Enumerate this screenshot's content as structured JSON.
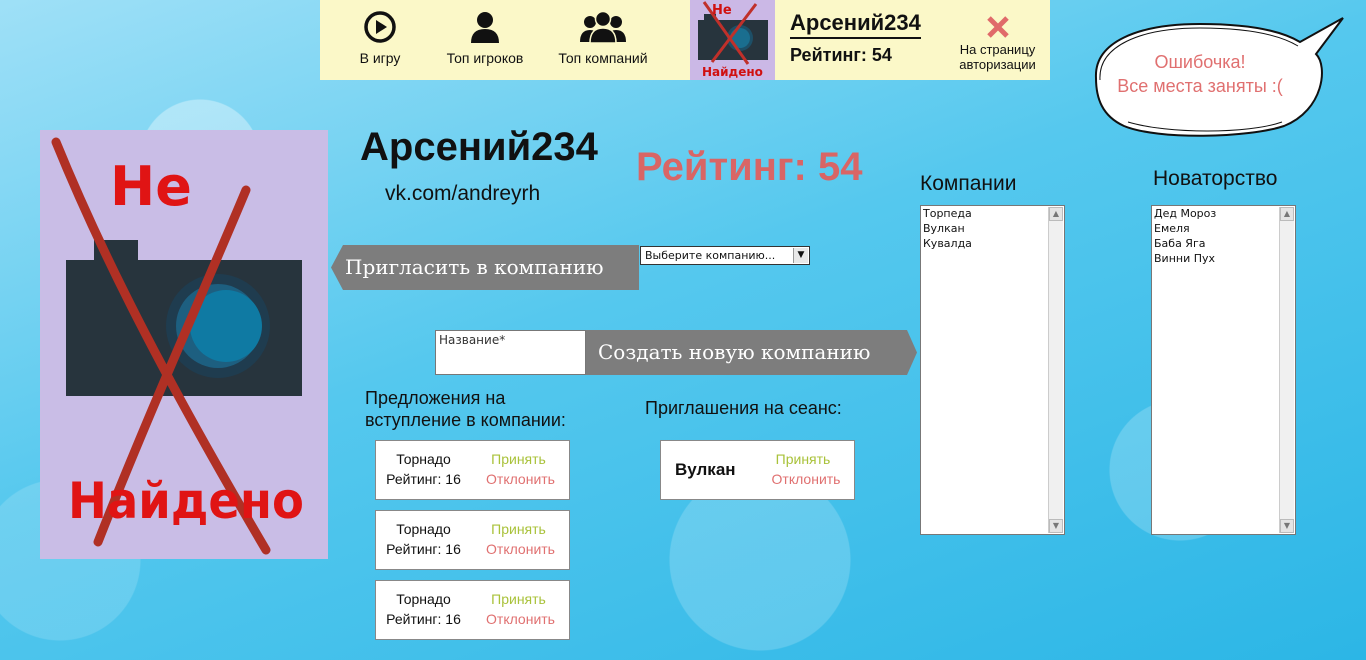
{
  "nav": {
    "play_label": "В игру",
    "top_players_label": "Топ игроков",
    "top_companies_label": "Топ компаний"
  },
  "header": {
    "username": "Арсений234",
    "rating": "Рейтинг: 54",
    "logout_line1": "На страницу",
    "logout_line2": "авторизации"
  },
  "notice": {
    "line1": "Ошибочка!",
    "line2": "Все места заняты :("
  },
  "profile": {
    "name": "Арсений234",
    "link": "vk.com/andreyrh",
    "rating": "Рейтинг: 54",
    "avatar_text_top": "Не",
    "avatar_text_bottom": "Найдено"
  },
  "invite": {
    "button_label": "Пригласить в компанию",
    "select_value": "Выберите компанию..."
  },
  "create": {
    "name_placeholder": "Название*",
    "button_label": "Создать новую компанию"
  },
  "offers": {
    "title_line1": "Предложения на",
    "title_line2": "вступление в компании:",
    "items": [
      {
        "company": "Торнадо",
        "rating": "Рейтинг: 16",
        "accept": "Принять",
        "decline": "Отклонить"
      },
      {
        "company": "Торнадо",
        "rating": "Рейтинг: 16",
        "accept": "Принять",
        "decline": "Отклонить"
      },
      {
        "company": "Торнадо",
        "rating": "Рейтинг: 16",
        "accept": "Принять",
        "decline": "Отклонить"
      }
    ]
  },
  "sessions": {
    "title": "Приглашения на сеанс:",
    "items": [
      {
        "company": "Вулкан",
        "accept": "Принять",
        "decline": "Отклонить"
      }
    ]
  },
  "companies": {
    "title": "Компании",
    "items": [
      "Торпеда",
      "Вулкан",
      "Кувалда"
    ]
  },
  "innovation": {
    "title": "Новаторство",
    "items": [
      "Дед Мороз",
      "Емеля",
      "Баба Яга",
      "Винни Пух"
    ]
  },
  "colors": {
    "topbar_bg": "#fbf8c8",
    "rating_red": "#d96565",
    "accept_green": "#a9c23a",
    "decline_red": "#e07070",
    "button_gray": "#7d7d7d"
  }
}
